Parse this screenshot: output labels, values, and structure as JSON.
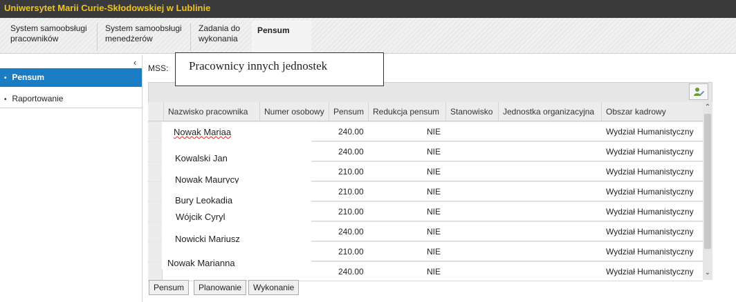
{
  "header": {
    "title": "Uniwersytet Marii Curie-Skłodowskiej w Lublinie"
  },
  "tabs": [
    {
      "label_line1": "System samoobsługi",
      "label_line2": "pracowników"
    },
    {
      "label_line1": "System samoobsługi",
      "label_line2": "menedżerów"
    },
    {
      "label_line1": "Zadania do",
      "label_line2": "wykonania"
    },
    {
      "label_line1": "Pensum",
      "label_line2": ""
    }
  ],
  "active_tab": "Pensum",
  "sidebar": {
    "collapse_icon": "chevron-left-icon",
    "items": [
      {
        "label": "Pensum",
        "active": true
      },
      {
        "label": "Raportowanie",
        "active": false
      }
    ]
  },
  "mss_label": "MSS:",
  "popup": {
    "text": "Pracownicy innych jednostek"
  },
  "table": {
    "columns": [
      "Nazwisko pracownika",
      "Numer osobowy",
      "Pensum",
      "Redukcja pensum",
      "Stanowisko",
      "Jednostka organizacyjna",
      "Obszar kadrowy"
    ],
    "rows": [
      {
        "pensum": "240.00",
        "redukcja": "NIE",
        "obszar": "Wydział Humanistyczny"
      },
      {
        "pensum": "240.00",
        "redukcja": "NIE",
        "obszar": "Wydział Humanistyczny"
      },
      {
        "pensum": "210.00",
        "redukcja": "NIE",
        "obszar": "Wydział Humanistyczny"
      },
      {
        "pensum": "210.00",
        "redukcja": "NIE",
        "obszar": "Wydział Humanistyczny"
      },
      {
        "pensum": "210.00",
        "redukcja": "NIE",
        "obszar": "Wydział Humanistyczny"
      },
      {
        "pensum": "240.00",
        "redukcja": "NIE",
        "obszar": "Wydział Humanistyczny"
      },
      {
        "pensum": "210.00",
        "redukcja": "NIE",
        "obszar": "Wydział Humanistyczny"
      },
      {
        "pensum": "240.00",
        "redukcja": "NIE",
        "obszar": "Wydział Humanistyczny"
      }
    ],
    "names": [
      "Nowak Mariaa",
      "Kowalski Jan",
      "Nowak Maurycy",
      "Bury Leokadia",
      "Wójcik Cyryl",
      "Nowicki Mariusz",
      "Nowak Marianna"
    ]
  },
  "buttons": {
    "pensum": "Pensum",
    "planowanie": "Planowanie",
    "wykonanie": "Wykonanie"
  },
  "colors": {
    "banner_bg": "#3a3a3a",
    "banner_text": "#f0c419",
    "sidebar_active": "#1a7dc4"
  }
}
